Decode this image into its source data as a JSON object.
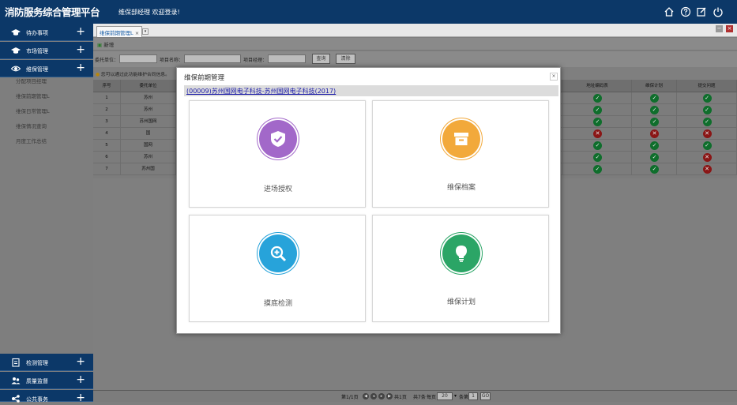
{
  "header": {
    "title": "消防服务综合管理平台",
    "welcome": "维保部经理 欢迎登录!"
  },
  "sidebar": {
    "top_items": [
      {
        "label": "待办事项",
        "icon": "graduation-cap-icon"
      },
      {
        "label": "市场管理",
        "icon": "graduation-cap-icon"
      },
      {
        "label": "维保管理",
        "icon": "eye-icon"
      }
    ],
    "sub_items": [
      "分配项目经理",
      "维保前期管理L",
      "维保日常管理L",
      "维保情况查询",
      "月度工作总结"
    ],
    "bottom_items": [
      {
        "label": "检测管理",
        "icon": "clipboard-icon"
      },
      {
        "label": "质量监督",
        "icon": "users-icon"
      },
      {
        "label": "公共事务",
        "icon": "share-icon"
      }
    ],
    "expand_symbol": "+"
  },
  "tabs": {
    "active": "维保前期管理L",
    "close": "×"
  },
  "toolbar": {
    "add_label": "新增",
    "min": "−",
    "close": "×"
  },
  "filter": {
    "client_label": "委托单位：",
    "project_label": "项目名称：",
    "manager_label": "项目经理：",
    "search_button": "查询",
    "clear_button": "清除"
  },
  "hint": "您可以通过此功能维护合同信息。",
  "table": {
    "col_index": "序号",
    "col_client": "委托单位",
    "col_address": "地址编码表",
    "col_plan": "维保计划",
    "col_issue": "提交问题",
    "rows": [
      {
        "index": "1",
        "client": "苏州",
        "address": "ok",
        "plan": "ok",
        "issue": "ok"
      },
      {
        "index": "2",
        "client": "苏州",
        "address": "ok",
        "plan": "ok",
        "issue": "ok"
      },
      {
        "index": "3",
        "client": "苏州国网",
        "address": "ok",
        "plan": "ok",
        "issue": "ok"
      },
      {
        "index": "4",
        "client": "国",
        "address": "no",
        "plan": "no",
        "issue": "no"
      },
      {
        "index": "5",
        "client": "国网",
        "address": "ok",
        "plan": "ok",
        "issue": "ok"
      },
      {
        "index": "6",
        "client": "苏州",
        "address": "ok",
        "plan": "ok",
        "issue": "no"
      },
      {
        "index": "7",
        "client": "苏州国",
        "address": "ok",
        "plan": "ok",
        "issue": "no"
      }
    ],
    "status_colors": {
      "ok": "#0f6e2c",
      "no": "#8a1616"
    }
  },
  "pager": {
    "page_info": "第1/1页",
    "total_pages": "共1页",
    "total_records": "共7条",
    "per_page_label": "每页",
    "per_page": "20",
    "per_page_unit": "条",
    "goto_label": "第",
    "goto_value": "1",
    "go_button": "GO"
  },
  "modal": {
    "title": "维保前期管理",
    "close": "×",
    "project_link": "(00009)苏州国网电子科技-苏州国网电子科技(2017)",
    "cards": [
      {
        "label": "进场授权",
        "color": "#a268c9",
        "icon": "shield-check-icon"
      },
      {
        "label": "维保档案",
        "color": "#f2a93b",
        "icon": "archive-box-icon"
      },
      {
        "label": "摸底检测",
        "color": "#27a3da",
        "icon": "magnifier-plus-icon"
      },
      {
        "label": "维保计划",
        "color": "#2ba566",
        "icon": "lightbulb-icon"
      }
    ]
  }
}
